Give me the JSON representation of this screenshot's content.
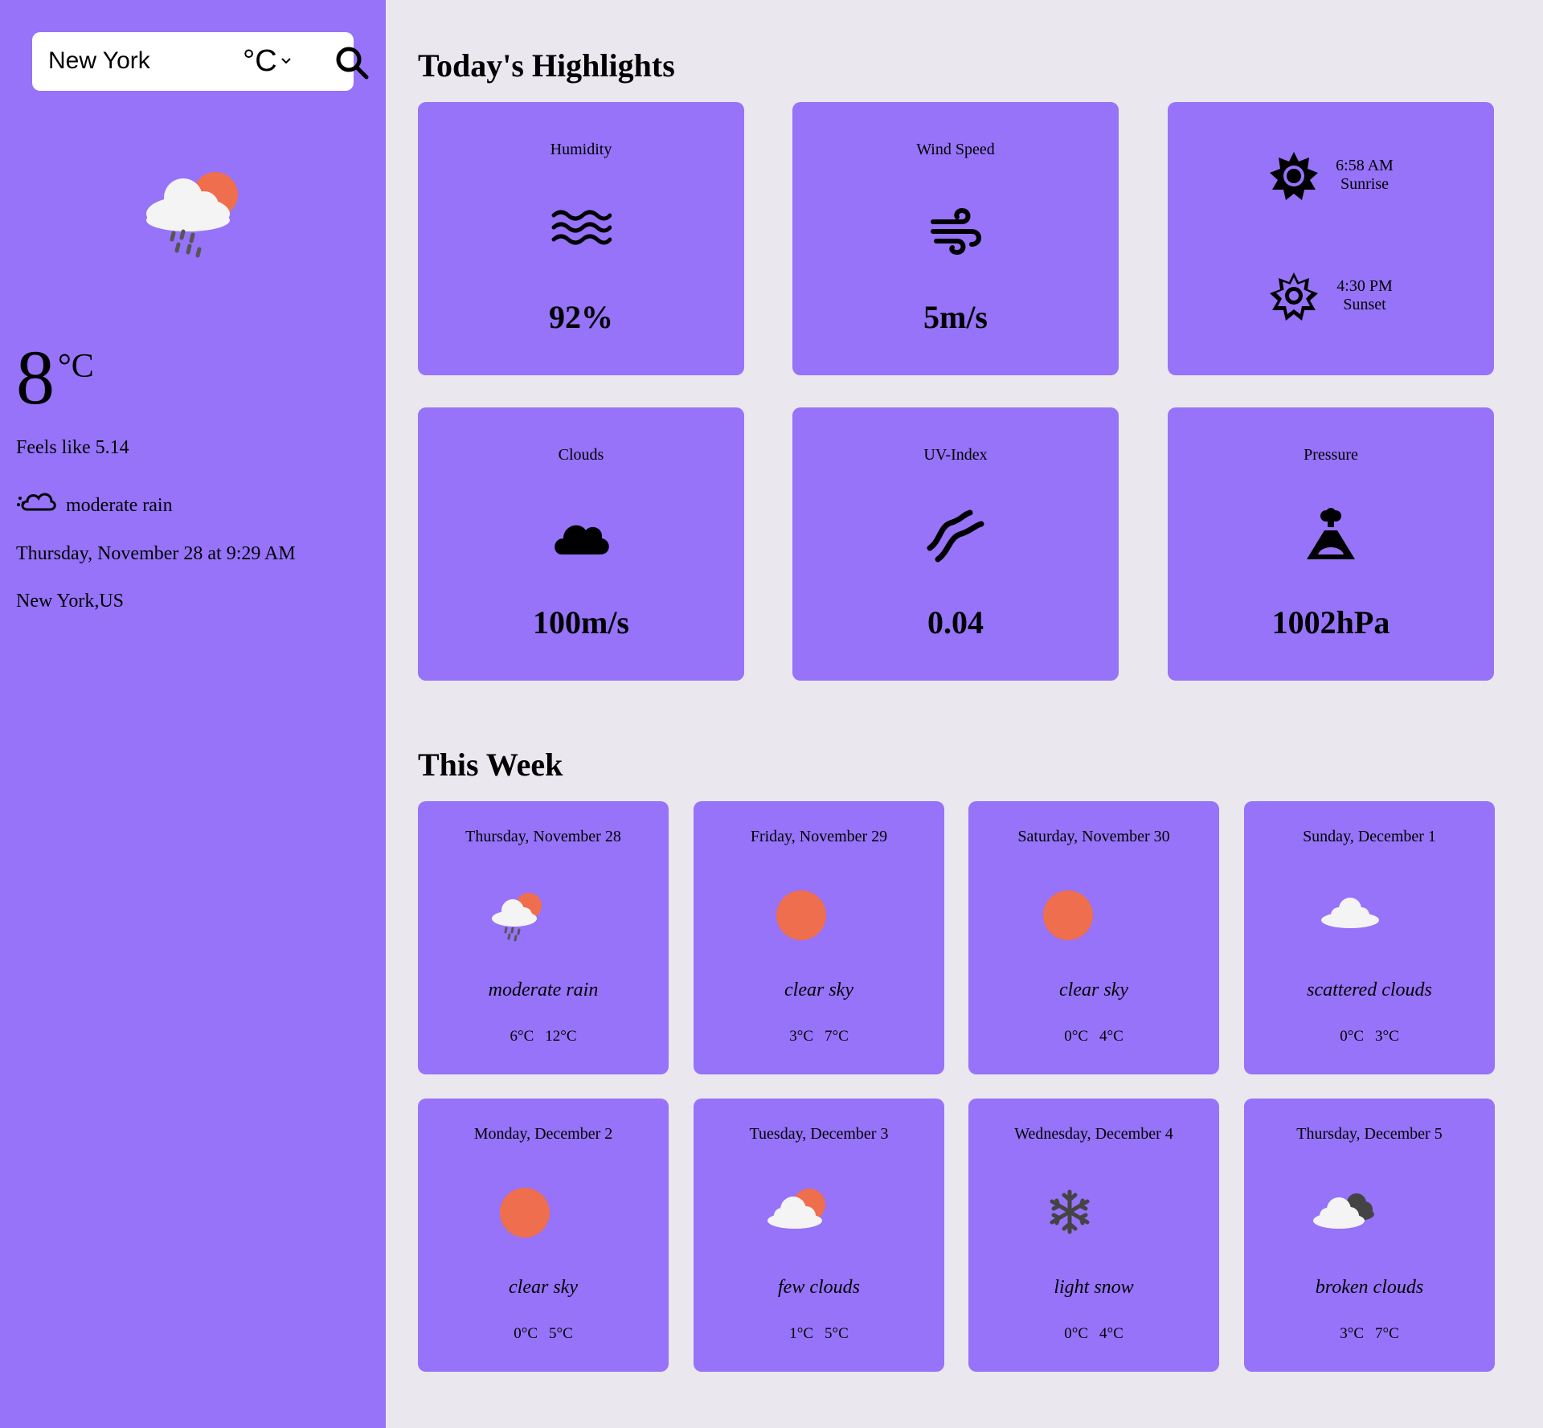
{
  "search": {
    "value": "New York",
    "unit": "°C"
  },
  "current": {
    "temp": "8",
    "unit": "°C",
    "feels_like": "Feels like 5.14",
    "description": "moderate rain",
    "datetime": "Thursday, November 28 at 9:29 AM",
    "location": "New York,US"
  },
  "highlights_title": "Today's Highlights",
  "highlights": {
    "humidity": {
      "label": "Humidity",
      "value": "92%"
    },
    "wind": {
      "label": "Wind Speed",
      "value": "5m/s"
    },
    "sunrise": {
      "time": "6:58 AM",
      "label": "Sunrise"
    },
    "sunset": {
      "time": "4:30 PM",
      "label": "Sunset"
    },
    "clouds": {
      "label": "Clouds",
      "value": "100m/s"
    },
    "uv": {
      "label": "UV-Index",
      "value": "0.04"
    },
    "pressure": {
      "label": "Pressure",
      "value": "1002hPa"
    }
  },
  "week_title": "This Week",
  "week": [
    {
      "date": "Thursday, November 28",
      "desc": "moderate rain",
      "min": "6°C",
      "max": "12°C",
      "icon": "rain-cloud-sun-icon"
    },
    {
      "date": "Friday, November 29",
      "desc": "clear sky",
      "min": "3°C",
      "max": "7°C",
      "icon": "sun-icon"
    },
    {
      "date": "Saturday, November 30",
      "desc": "clear sky",
      "min": "0°C",
      "max": "4°C",
      "icon": "sun-icon"
    },
    {
      "date": "Sunday, December 1",
      "desc": "scattered clouds",
      "min": "0°C",
      "max": "3°C",
      "icon": "cloud-icon"
    },
    {
      "date": "Monday, December 2",
      "desc": "clear sky",
      "min": "0°C",
      "max": "5°C",
      "icon": "sun-icon"
    },
    {
      "date": "Tuesday, December 3",
      "desc": "few clouds",
      "min": "1°C",
      "max": "5°C",
      "icon": "cloud-sun-icon"
    },
    {
      "date": "Wednesday, December 4",
      "desc": "light snow",
      "min": "0°C",
      "max": "4°C",
      "icon": "snowflake-icon"
    },
    {
      "date": "Thursday, December 5",
      "desc": "broken clouds",
      "min": "3°C",
      "max": "7°C",
      "icon": "broken-clouds-icon"
    }
  ],
  "colors": {
    "sidebar": "#9673f8",
    "card": "#9673f8",
    "background": "#eae7ef",
    "sun": "#ee6e4d",
    "cloud": "#f4f4f4"
  }
}
